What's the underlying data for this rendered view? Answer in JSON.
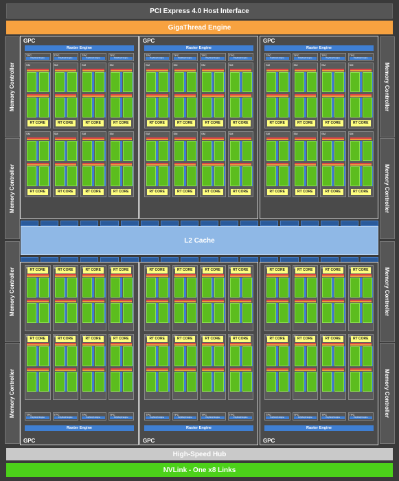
{
  "header": {
    "pci": "PCI Express 4.0 Host Interface",
    "gigathread": "GigaThread Engine"
  },
  "footer": {
    "hub": "High-Speed Hub",
    "nvlink": "NVLink - One x8 Links"
  },
  "memory_controller": "Memory Controller",
  "l2": "L2 Cache",
  "gpc_label": "GPC",
  "raster": "Raster Engine",
  "tpc_label": "TPC",
  "polymorph": "PolyMorph Engine",
  "sm_label": "SM",
  "rt_core": "RT CORE",
  "colors": {
    "background": "#3a3a3a",
    "gigathread": "#f7a240",
    "nvlink": "#4cd11a",
    "raster": "#3f7fd3",
    "l2": "#8fb8e6",
    "sm_core": "#5cbd1e",
    "rt_core": "#ffff80"
  }
}
